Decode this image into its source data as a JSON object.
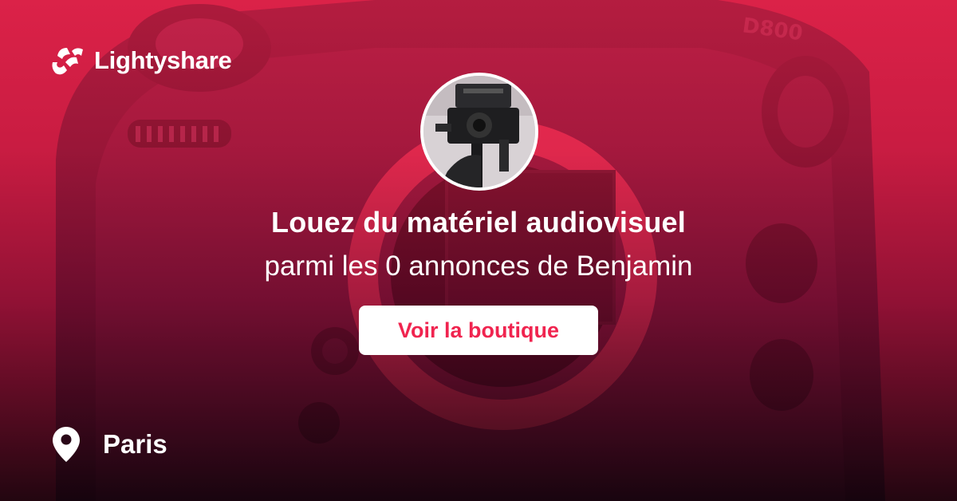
{
  "brand": {
    "name": "Lightyshare",
    "logo_icon": "lightyshare-logo-icon",
    "accent_color": "#f0244f"
  },
  "profile": {
    "avatar_icon": "camera-rig-avatar"
  },
  "hero": {
    "headline": "Louez du matériel audiovisuel",
    "subline": "parmi les 0 annonces de Benjamin"
  },
  "cta": {
    "label": "Voir la boutique"
  },
  "location": {
    "icon": "map-pin-icon",
    "city": "Paris"
  }
}
